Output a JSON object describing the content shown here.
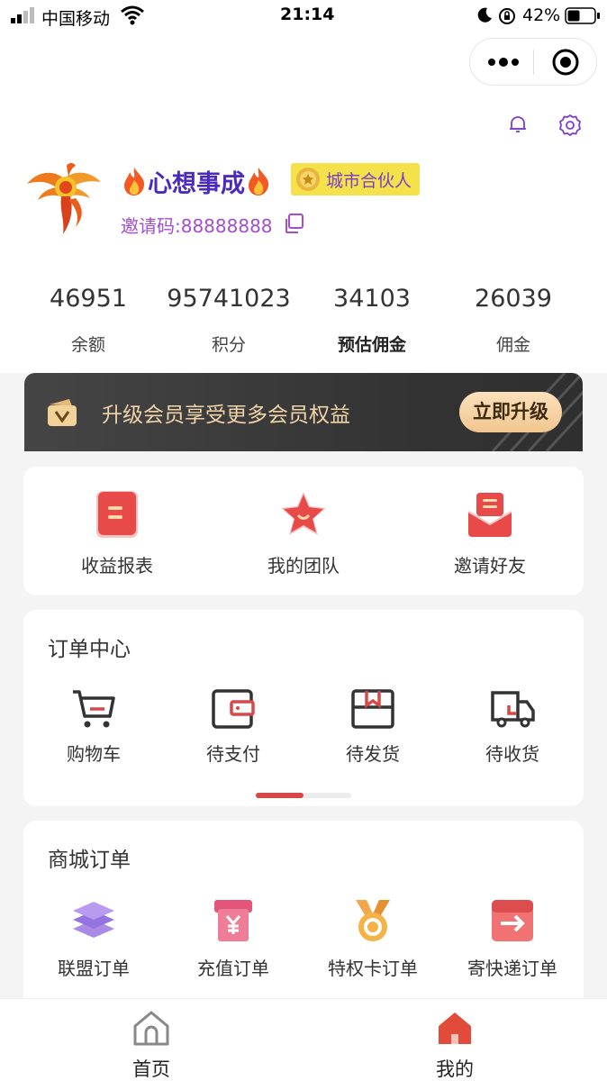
{
  "status_bar": {
    "carrier": "中国移动",
    "time": "21:14",
    "battery": "42%"
  },
  "profile": {
    "nickname": "心想事成",
    "role": "城市合伙人",
    "invite_code": "邀请码:88888888"
  },
  "stats": [
    {
      "value": "46951",
      "label": "余额"
    },
    {
      "value": "95741023",
      "label": "积分"
    },
    {
      "value": "34103",
      "label": "预估佣金"
    },
    {
      "value": "26039",
      "label": "佣金"
    }
  ],
  "upgrade": {
    "text": "升级会员享受更多会员权益",
    "button": "立即升级"
  },
  "quick_actions": [
    {
      "label": "收益报表",
      "icon": "report-icon"
    },
    {
      "label": "我的团队",
      "icon": "star-team-icon"
    },
    {
      "label": "邀请好友",
      "icon": "invite-envelope-icon"
    }
  ],
  "order_center": {
    "title": "订单中心",
    "items": [
      {
        "label": "购物车",
        "icon": "cart-icon"
      },
      {
        "label": "待支付",
        "icon": "wallet-icon"
      },
      {
        "label": "待发货",
        "icon": "package-icon"
      },
      {
        "label": "待收货",
        "icon": "truck-icon"
      }
    ],
    "scroll_progress": 0.5
  },
  "mall_orders": {
    "title": "商城订单",
    "items": [
      {
        "label": "联盟订单",
        "icon": "layers-icon"
      },
      {
        "label": "充值订单",
        "icon": "yen-box-icon"
      },
      {
        "label": "特权卡订单",
        "icon": "medal-icon"
      },
      {
        "label": "寄快递订单",
        "icon": "arrow-box-icon"
      }
    ]
  },
  "tab_bar": [
    {
      "label": "首页",
      "icon": "home-outline-icon",
      "active": false
    },
    {
      "label": "我的",
      "icon": "home-filled-icon",
      "active": true
    }
  ],
  "colors": {
    "accent_red": "#d94848",
    "nickname_purple": "#4b2bbf",
    "invite_purple": "#a34ed0",
    "badge_yellow": "#f5e14a",
    "banner_gold": "#f0d4a8"
  }
}
